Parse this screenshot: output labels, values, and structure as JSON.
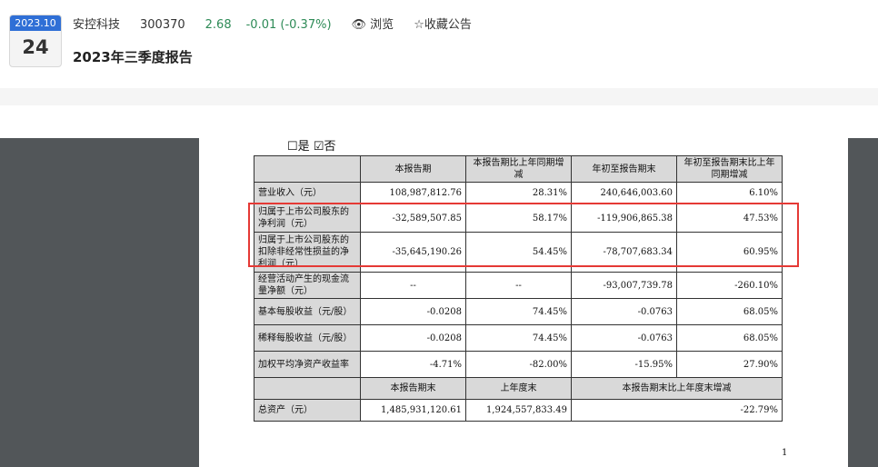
{
  "header": {
    "date_month": "2023.10",
    "date_day": "24",
    "company": "安控科技",
    "code": "300370",
    "price": "2.68",
    "change": "-0.01 (-0.37%)",
    "browse_label": "浏览",
    "favorite_label": "收藏公告",
    "title": "2023年三季度报告"
  },
  "colors": {
    "accent_blue": "#2f6fd6",
    "up_green": "#2e8b57",
    "highlight_red": "#e53935"
  },
  "document": {
    "checkbox_yes": "是",
    "checkbox_no": "否",
    "columns": [
      "本报告期",
      "本报告期比上年同期增减",
      "年初至报告期末",
      "年初至报告期末比上年同期增减"
    ],
    "rows": [
      {
        "label": "营业收入（元）",
        "v1": "108,987,812.76",
        "v2": "28.31%",
        "v3": "240,646,003.60",
        "v4": "6.10%"
      },
      {
        "label": "归属于上市公司股东的净利润（元）",
        "v1": "-32,589,507.85",
        "v2": "58.17%",
        "v3": "-119,906,865.38",
        "v4": "47.53%"
      },
      {
        "label": "归属于上市公司股东的扣除非经常性损益的净利润（元）",
        "v1": "-35,645,190.26",
        "v2": "54.45%",
        "v3": "-78,707,683.34",
        "v4": "60.95%"
      },
      {
        "label": "经营活动产生的现金流量净额（元）",
        "v1": "--",
        "v2": "--",
        "v3": "-93,007,739.78",
        "v4": "-260.10%"
      },
      {
        "label": "基本每股收益（元/股）",
        "v1": "-0.0208",
        "v2": "74.45%",
        "v3": "-0.0763",
        "v4": "68.05%"
      },
      {
        "label": "稀释每股收益（元/股）",
        "v1": "-0.0208",
        "v2": "74.45%",
        "v3": "-0.0763",
        "v4": "68.05%"
      },
      {
        "label": "加权平均净资产收益率",
        "v1": "-4.71%",
        "v2": "-82.00%",
        "v3": "-15.95%",
        "v4": "27.90%"
      }
    ],
    "columns2": [
      "本报告期末",
      "上年度末",
      "本报告期末比上年度末增减"
    ],
    "assets": {
      "label": "总资产（元）",
      "v1": "1,485,931,120.61",
      "v2": "1,924,557,833.49",
      "v3": "-22.79%"
    },
    "page_number": "1"
  }
}
